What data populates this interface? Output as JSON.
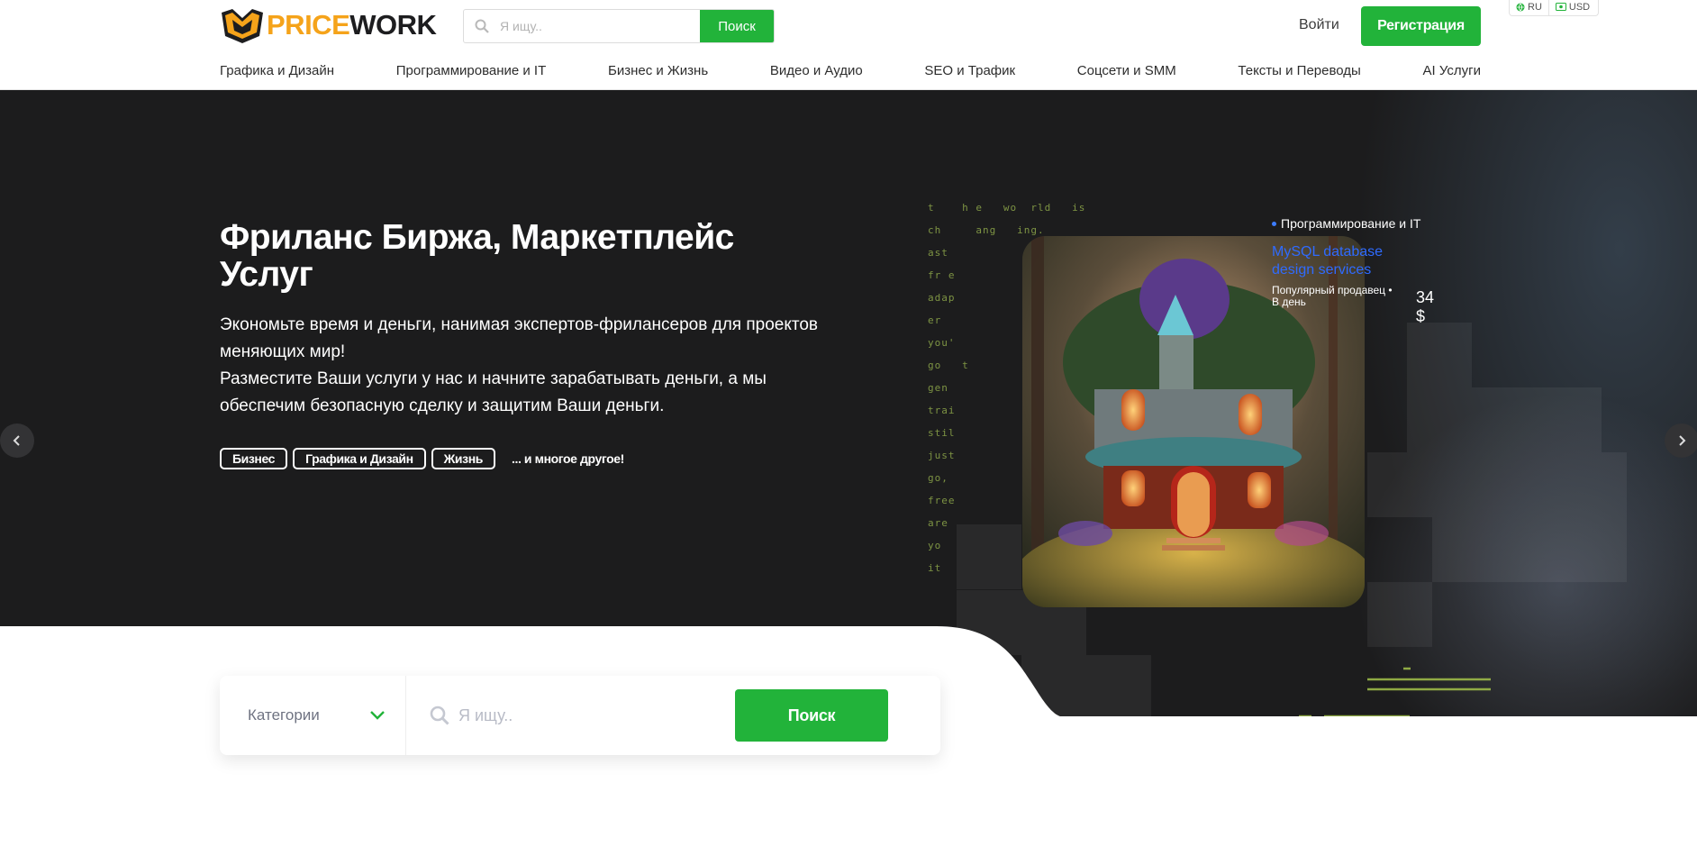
{
  "brand": {
    "name_part1": "PRICE",
    "name_part2": "WORK",
    "accent_color": "#f5a31a",
    "green": "#22b33a"
  },
  "header": {
    "search": {
      "placeholder": "Я ищу..",
      "button": "Поиск"
    },
    "login": "Войти",
    "register": "Регистрация",
    "language": "RU",
    "currency": "USD"
  },
  "nav": [
    "Графика и Дизайн",
    "Программирование и IT",
    "Бизнес и Жизнь",
    "Видео и Аудио",
    "SEO и Трафик",
    "Соцсети и SMM",
    "Тексты и Переводы",
    "AI Услуги"
  ],
  "hero": {
    "title": "Фриланс Биржа, Маркетплейс Услуг",
    "subtitle_line1": "Экономьте время и деньги, нанимая экспертов-фрилансеров для проектов меняющих мир!",
    "subtitle_line2": "Разместите Ваши услуги у нас и начните зарабатывать деньги, а мы обеспечим безопасную сделку и защитим Ваши деньги.",
    "tags": [
      "Бизнес",
      "Графика и Дизайн",
      "Жизнь"
    ],
    "tags_more": "... и многое другое!",
    "matrix_text": "t    h e   wo  rld   is\nch     ang   ing.\nast   \nfr e\nadap\ner\nyou'\ngo   t\ngen\ntrai\nstil\njust\ngo,\nfree\nare\nyo\nit",
    "card": {
      "category": "Программирование и IT",
      "title": "MySQL database design services",
      "seller": "Популярный продавец",
      "per": "В день",
      "price": "34 $"
    }
  },
  "search_bar": {
    "categories_label": "Категории",
    "placeholder": "Я ищу..",
    "button": "Поиск"
  },
  "icons": [
    "logo-icon",
    "search-icon",
    "globe-icon",
    "currency-icon",
    "chevron-left-icon",
    "chevron-right-icon",
    "chevron-down-icon",
    "search-icon"
  ]
}
